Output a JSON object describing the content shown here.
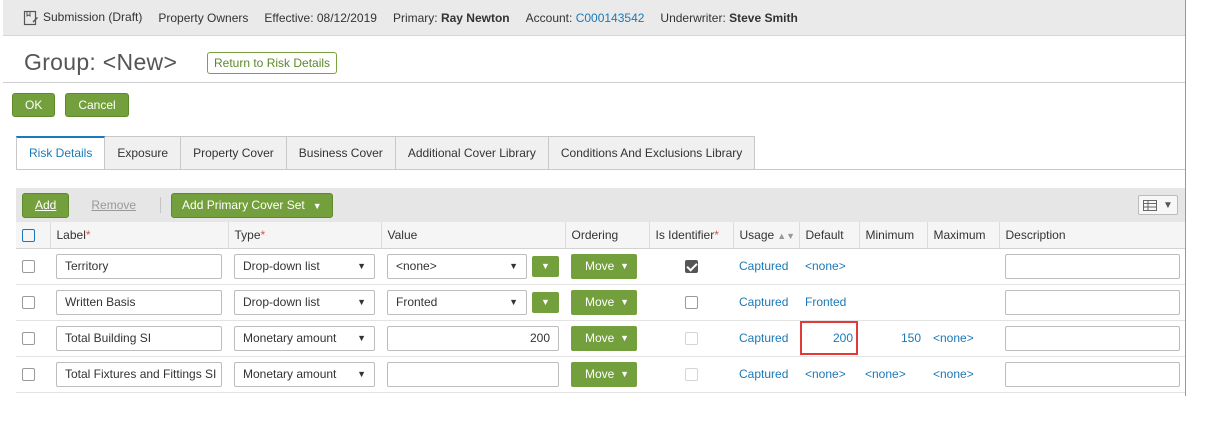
{
  "topbar": {
    "submission": "Submission (Draft)",
    "product": "Property Owners",
    "effective_label": "Effective:",
    "effective_value": "08/12/2019",
    "primary_label": "Primary:",
    "primary_value": "Ray Newton",
    "account_label": "Account:",
    "account_value": "C000143542",
    "underwriter_label": "Underwriter:",
    "underwriter_value": "Steve Smith"
  },
  "page": {
    "title": "Group: <New>",
    "return_button": "Return to Risk Details",
    "ok": "OK",
    "cancel": "Cancel"
  },
  "tabs": [
    {
      "label": "Risk Details",
      "active": true
    },
    {
      "label": "Exposure"
    },
    {
      "label": "Property Cover"
    },
    {
      "label": "Business Cover"
    },
    {
      "label": "Additional Cover Library"
    },
    {
      "label": "Conditions And Exclusions Library"
    }
  ],
  "toolbar": {
    "add": "Add",
    "remove": "Remove",
    "add_primary_cover_set": "Add Primary Cover Set",
    "column_toggle_icon": "grid-columns-icon"
  },
  "columns": {
    "label": "Label",
    "type": "Type",
    "value": "Value",
    "ordering": "Ordering",
    "is_identifier": "Is Identifier",
    "usage": "Usage",
    "default": "Default",
    "minimum": "Minimum",
    "maximum": "Maximum",
    "description": "Description",
    "required_mark": "*"
  },
  "rows": [
    {
      "label": "Territory",
      "type": "Drop-down list",
      "value": "<none>",
      "ordering": "Move",
      "usage": "Captured",
      "default": "<none>",
      "minimum": "",
      "maximum": "",
      "description": ""
    },
    {
      "label": "Written Basis",
      "type": "Drop-down list",
      "value": "Fronted",
      "ordering": "Move",
      "usage": "Captured",
      "default": "Fronted",
      "minimum": "",
      "maximum": "",
      "description": ""
    },
    {
      "label": "Total Building SI",
      "type": "Monetary amount",
      "value": "200",
      "ordering": "Move",
      "usage": "Captured",
      "default": "200",
      "minimum": "150",
      "maximum": "<none>",
      "description": ""
    },
    {
      "label": "Total Fixtures and Fittings SI",
      "type": "Monetary amount",
      "value": "",
      "ordering": "Move",
      "usage": "Captured",
      "default": "<none>",
      "minimum": "<none>",
      "maximum": "<none>",
      "description": ""
    }
  ]
}
